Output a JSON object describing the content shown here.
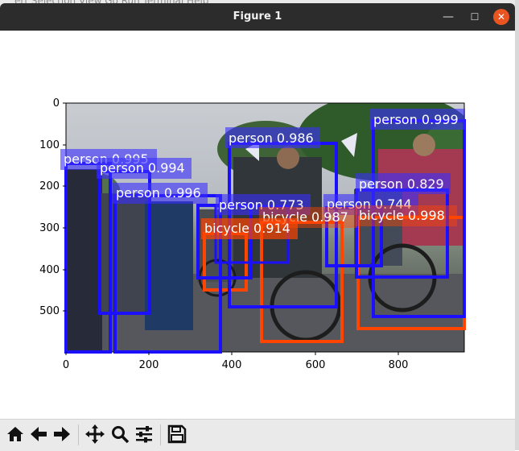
{
  "window": {
    "title": "Figure 1",
    "background_menu_text": "ert  Selection  View  Go  Run  Terminal  Help",
    "close_glyph": "✕",
    "minimize_glyph": "—",
    "maximize_glyph": "☐"
  },
  "axes": {
    "xticks": [
      "0",
      "200",
      "400",
      "600",
      "800"
    ],
    "yticks": [
      "0",
      "100",
      "200",
      "300",
      "400",
      "500"
    ],
    "image_description": "cyclists photo"
  },
  "detections": [
    {
      "label": "person 0.999",
      "color": "#1a10ff"
    },
    {
      "label": "person 0.986",
      "color": "#1a10ff"
    },
    {
      "label": "person 0.995",
      "color": "#1a10ff"
    },
    {
      "label": "person 0.994",
      "color": "#1a10ff"
    },
    {
      "label": "person 0.996",
      "color": "#1a10ff"
    },
    {
      "label": "person 0.829",
      "color": "#1a10ff"
    },
    {
      "label": "person 0.744",
      "color": "#1a10ff"
    },
    {
      "label": "person 0.773",
      "color": "#1a10ff"
    },
    {
      "label": "bicycle 0.987",
      "color": "#ff4500"
    },
    {
      "label": "bicycle 0.998",
      "color": "#ff4500"
    },
    {
      "label": "bicycle 0.914",
      "color": "#ff4500"
    }
  ],
  "toolbar": {
    "home": "home-icon",
    "back": "back-arrow-icon",
    "forward": "forward-arrow-icon",
    "pan": "pan-icon",
    "zoom": "zoom-icon",
    "configure": "configure-subplots-icon",
    "save": "save-icon"
  }
}
